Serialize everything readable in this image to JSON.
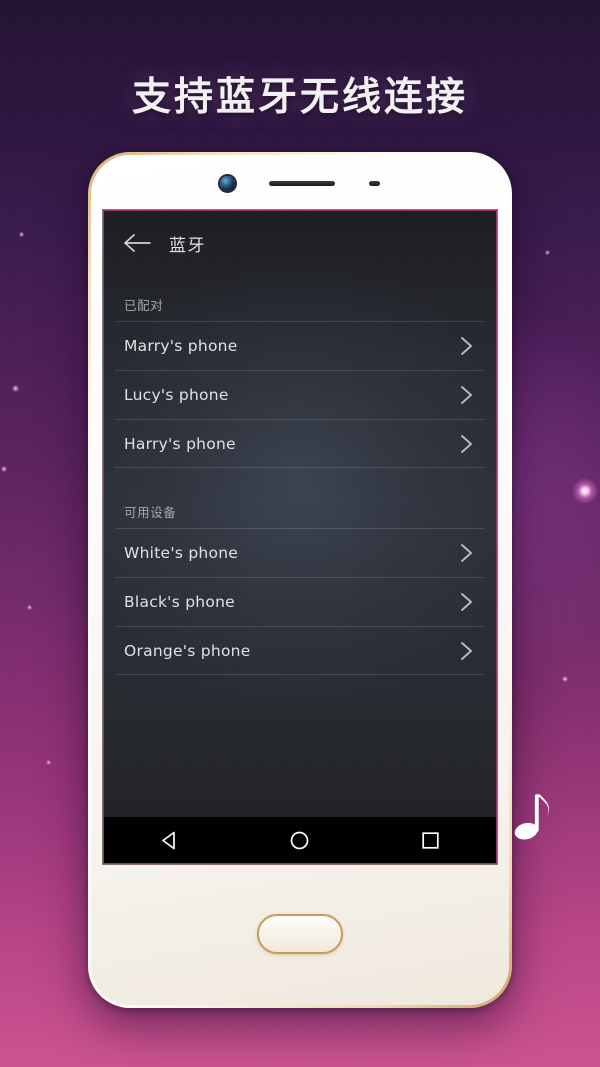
{
  "poster": {
    "headline": "支持蓝牙无线连接",
    "background_top_color": "#251433",
    "background_bottom_color": "#cb5390",
    "music_note_icon": "music-note-icon"
  },
  "phone": {
    "front_camera_icon": "front-camera-icon",
    "earpiece_icon": "earpiece-speaker-icon",
    "proximity_sensor_icon": "proximity-sensor-icon",
    "home_button_label": "home-button"
  },
  "app": {
    "back_icon": "back-arrow-icon",
    "title": "蓝牙",
    "sections": [
      {
        "header": "已配对",
        "devices": [
          {
            "name": "Marry's phone",
            "chevron_icon": "chevron-right-icon"
          },
          {
            "name": "Lucy's phone",
            "chevron_icon": "chevron-right-icon"
          },
          {
            "name": "Harry's phone",
            "chevron_icon": "chevron-right-icon"
          }
        ]
      },
      {
        "header": "可用设备",
        "devices": [
          {
            "name": "White's phone",
            "chevron_icon": "chevron-right-icon"
          },
          {
            "name": "Black's phone",
            "chevron_icon": "chevron-right-icon"
          },
          {
            "name": "Orange's phone",
            "chevron_icon": "chevron-right-icon"
          }
        ]
      }
    ],
    "screen_background_color": "#2c3039",
    "text_color": "#dfe1e4",
    "section_header_color": "#a5a8ad"
  },
  "navbar": {
    "back_icon": "nav-back-triangle-icon",
    "home_icon": "nav-home-circle-icon",
    "recents_icon": "nav-recents-square-icon"
  }
}
